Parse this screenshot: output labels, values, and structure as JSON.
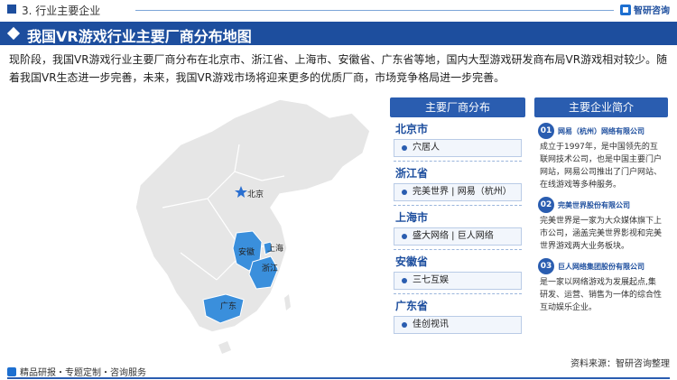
{
  "header": {
    "section_label": "3. 行业主要企业",
    "brand": "智研咨询",
    "title": "我国VR游戏行业主要厂商分布地图"
  },
  "intro": "现阶段，我国VR游戏行业主要厂商分布在北京市、浙江省、上海市、安徽省、广东省等地，国内大型游戏研发商布局VR游戏相对较少。随着我国VR生态进一步完善，未来，我国VR游戏市场将迎来更多的优质厂商，市场竞争格局进一步完善。",
  "map_labels": {
    "beijing": "北京",
    "anhui": "安徽",
    "shanghai": "上海",
    "zhejiang": "浙江",
    "guangdong": "广东"
  },
  "distribution": {
    "heading": "主要厂商分布",
    "regions": [
      {
        "name": "北京市",
        "companies": "穴居人"
      },
      {
        "name": "浙江省",
        "companies": "完美世界 | 网易（杭州）"
      },
      {
        "name": "上海市",
        "companies": "盛大网络 | 巨人网络"
      },
      {
        "name": "安徽省",
        "companies": "三七互娱"
      },
      {
        "name": "广东省",
        "companies": "佳创视讯"
      }
    ]
  },
  "companies_intro": {
    "heading": "主要企业简介",
    "items": [
      {
        "num": "01",
        "name": "网易（杭州）网络有限公司",
        "desc": "成立于1997年，是中国领先的互联网技术公司，也是中国主要门户网站，网易公司推出了门户网站、在线游戏等多种服务。"
      },
      {
        "num": "02",
        "name": "完美世界股份有限公司",
        "desc": "完美世界是一家为大众媒体旗下上市公司，涵盖完美世界影视和完美世界游戏两大业务板块。"
      },
      {
        "num": "03",
        "name": "巨人网络集团股份有限公司",
        "desc": "是一家以网络游戏为发展起点,集研发、运营、销售为一体的综合性互动娱乐企业。"
      }
    ]
  },
  "footer": {
    "left": "精品研报・专题定制・咨询服务",
    "source": "资料来源：智研咨询整理"
  },
  "colors": {
    "primary": "#1d4e9e",
    "highlight_province": "#3a8fdc",
    "map_base": "#e6e6e6"
  }
}
